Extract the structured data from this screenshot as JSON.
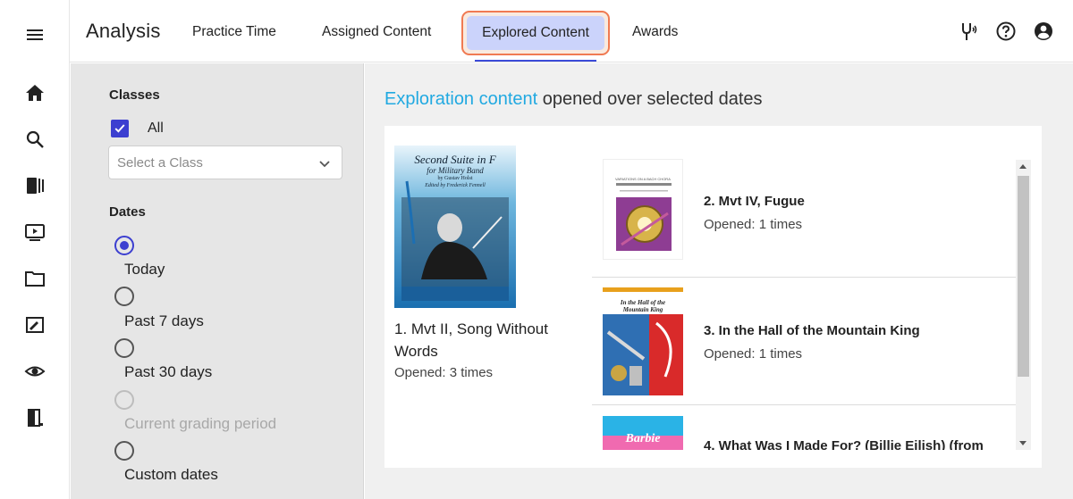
{
  "header": {
    "app_title": "Analysis",
    "tabs": [
      {
        "label": "Practice Time"
      },
      {
        "label": "Assigned Content"
      },
      {
        "label": "Explored Content",
        "active": true
      },
      {
        "label": "Awards"
      }
    ]
  },
  "filters": {
    "classes_label": "Classes",
    "all_label": "All",
    "all_checked": true,
    "class_select_placeholder": "Select a Class",
    "dates_label": "Dates",
    "date_options": [
      {
        "label": "Today",
        "selected": true,
        "disabled": false
      },
      {
        "label": "Past 7 days",
        "selected": false,
        "disabled": false
      },
      {
        "label": "Past 30 days",
        "selected": false,
        "disabled": false
      },
      {
        "label": "Current grading period",
        "selected": false,
        "disabled": true
      },
      {
        "label": "Custom dates",
        "selected": false,
        "disabled": false
      }
    ]
  },
  "main": {
    "heading_accent": "Exploration content",
    "heading_rest": " opened over selected dates",
    "featured": {
      "title": "1. Mvt II, Song Without Words",
      "opened": "Opened: 3 times",
      "cover_title": "Second Suite in F",
      "cover_subtitle": "for Military Band",
      "cover_composer": "by Gustav Holst",
      "cover_editor": "Edited by Frederick Fennell"
    },
    "items": [
      {
        "title": "2. Mvt IV, Fugue",
        "opened": "Opened: 1 times",
        "cover_text": "VARIATIONS ON A BACH CHORALE"
      },
      {
        "title": "3. In the Hall of the Mountain King",
        "opened": "Opened: 1 times",
        "cover_text": "In the Hall of the Mountain King"
      },
      {
        "title": "4. What Was I Made For? (Billie Eilish) (from",
        "opened": "",
        "cover_text": "Barbie"
      }
    ]
  },
  "colors": {
    "accent_blue": "#21a9e1",
    "primary": "#3c3fd0",
    "highlight_border": "#f07a52",
    "active_tab_bg": "#cbd3fb"
  }
}
